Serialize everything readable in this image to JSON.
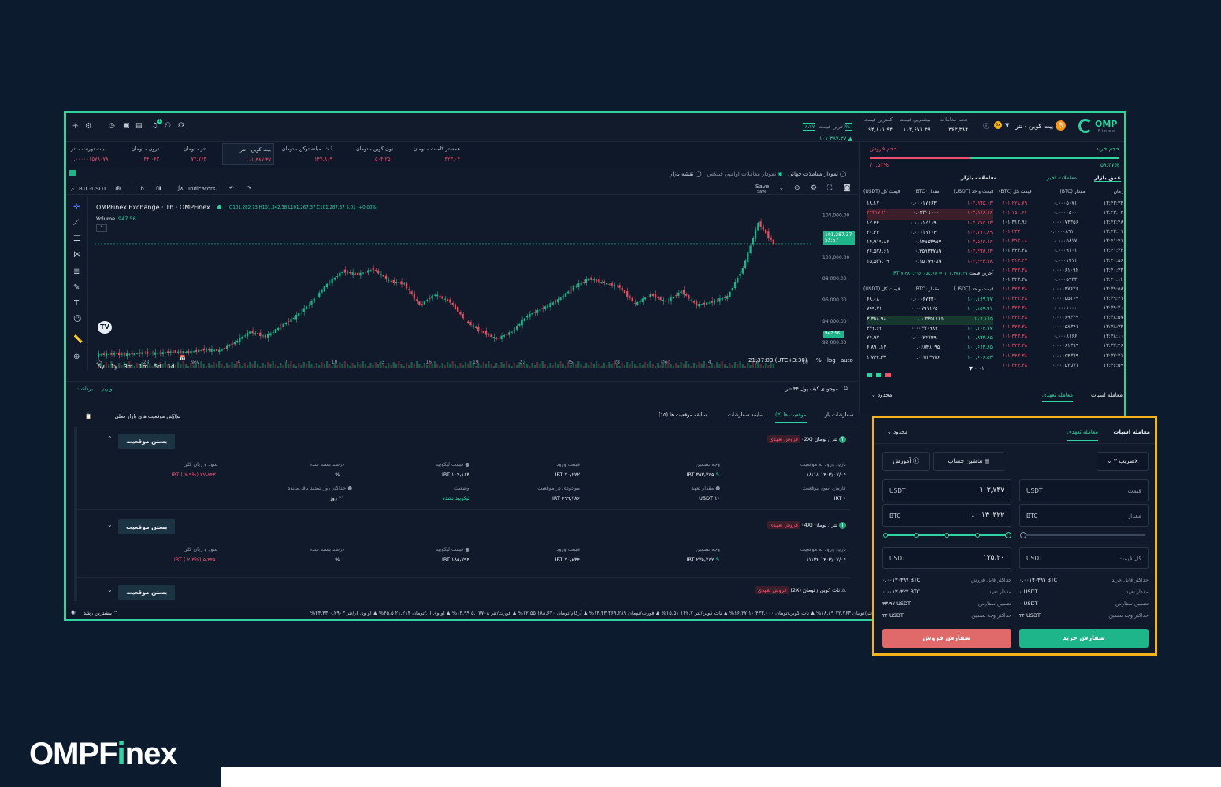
{
  "header": {
    "pair": "بیت کوین - تتر",
    "brand": "OMP",
    "brand_sub": "Finex",
    "stats": [
      {
        "label": "حجم معاملات",
        "value": "۳۶۳,۳۸۴"
      },
      {
        "label": "بیشترین قیمت",
        "value": "۱۰۳,۶۷۱.۳۹"
      },
      {
        "label": "کمترین قیمت",
        "value": "۹۴,۸۰۱.۹۴"
      },
      {
        "label": "آخرین قیمت",
        "value": "۱۰۱,۳۸۷.۳۷",
        "change": "۶.۷۷%"
      }
    ],
    "notif_count": "1"
  },
  "tickers": [
    {
      "name": "همستر کامبت - تومان",
      "value": "۳۲۳.۰۴"
    },
    {
      "name": "تون کوین - تومان",
      "value": "۵۰۴,۲۵۰"
    },
    {
      "name": "آ.ث. میلنه توکن - تومان",
      "value": "۱۴۷,۸۱۹"
    },
    {
      "name": "بیت کوین - تتر",
      "value": "۱۰۱,۳۸۷.۳۷"
    },
    {
      "name": "تتر - تومان",
      "value": "۷۲,۷۶۳"
    },
    {
      "name": "ترون - تومان",
      "value": "۴۴,۰۶۲"
    },
    {
      "name": "بیت تورنت - تتر",
      "value": "۰.۰۰۰۰۰۱۵۷۸۰۷۸"
    }
  ],
  "chart_opts": {
    "opt1": "نمودار معاملات جهانی",
    "opt2": "نمودار معاملات اوامپی فینکس",
    "opt3": "نقشه بازار"
  },
  "chart_toolbar": {
    "symbol": "BTC-USDT",
    "interval": "1h",
    "indicators": "Indicators",
    "save": "Save",
    "save_sub": "Save"
  },
  "chart_legend": {
    "title": "OMPFinex Exchange · 1h · OMPFinex",
    "ohlc": "O101,282.73 H101,342.38 L101,267.37 C101,287.37 5.01 (+0.00%)",
    "volume_label": "Volume",
    "volume_value": "947.56"
  },
  "chart_data": {
    "type": "line",
    "x": [
      "25",
      "28",
      "Nov",
      "4",
      "7",
      "10",
      "13",
      "16",
      "19",
      "22",
      "25",
      "28",
      "Dec",
      "4",
      "7",
      "10"
    ],
    "y_ticks": [
      "104,000.00",
      "102,000.00",
      "100,000.00",
      "98,000.00",
      "96,000.00",
      "94,000.00",
      "92,000.00"
    ],
    "ylim": [
      90500,
      105000
    ],
    "last_price": "101,287.37",
    "last_time": "52:57",
    "last_volume": "947.56",
    "values": [
      90800,
      90900,
      90850,
      91000,
      90950,
      91100,
      91050,
      91300,
      91200,
      92000,
      93000,
      92500,
      93500,
      94500,
      95800,
      97500,
      98700,
      98400,
      98900,
      97800,
      97500,
      95500,
      96500,
      95800,
      94000,
      93000,
      92300,
      93000,
      94500,
      95200,
      96000,
      97200,
      98000,
      97600,
      97200,
      95600,
      96500,
      95800,
      96800,
      95500,
      95800,
      96300,
      99000,
      103300,
      101300
    ]
  },
  "range_buttons": [
    "5y",
    "1y",
    "3m",
    "1m",
    "5d",
    "1d"
  ],
  "chart_footer": {
    "time": "21:37:03 (UTC+3:30)",
    "pct": "%",
    "log": "log",
    "auto": "auto"
  },
  "orderbook": {
    "buy_vol_label": "حجم خرید",
    "buy_vol": "۵۹.۴۷%",
    "sell_vol_label": "حجم فروش",
    "sell_vol": "۴۰.۵۳%",
    "tab_depth": "عمق بازار",
    "tab_trades": "معاملات اخیر",
    "tab_market": "معاملات بازار",
    "cols_left": [
      "قیمت واحد (USDT)",
      "مقدار (BTC)",
      "قیمت کل (USDT)"
    ],
    "cols_right": [
      "زمان",
      "مقدار (BTC)",
      "قیمت کل (BTC)"
    ],
    "asks": [
      [
        "۱۰۲,۹۳۵.۰۳",
        "۰.۰۰۰۱۷۶۶۳",
        "۱۸.۱۷"
      ],
      [
        "۱۰۲,۹۱۶.۶۶",
        "۰.۰۴۳۰۶۰۰۰",
        "۴۴۳۱۷.۲"
      ],
      [
        "۱۰۲,۷۷۵.۶۳",
        "۰.۰۰۰۱۲۱۰۹",
        "۱۲.۴۴"
      ],
      [
        "۱۰۲,۷۴۰.۸۹",
        "۰.۰۰۰۱۹۷۰۴",
        "۲۰.۲۴"
      ],
      [
        "۱۰۲,۵۱۶.۱۶",
        "۰.۱۴۵۵۳۹۵۹",
        "۱۴,۹۱۹.۸۶"
      ],
      [
        "۱۰۲,۴۳۸.۱۴",
        "۰.۲۵۹۴۳۷۸۷",
        "۲۶,۵۷۸.۶۱"
      ],
      [
        "۱۰۲,۴۹۳.۳۸",
        "۰.۱۵۱۷۹۰۸۷",
        "۱۵,۵۲۷.۱۹"
      ]
    ],
    "last_label": "آخرین قیمت",
    "last_value": "۱۰۱,۳۸۷.۳۷ = ۷,۳۸۱,۲۱۶,۰۵۵.۷۸ IRT",
    "bids": [
      [
        "۱۰۱,۱۶۹.۴۷",
        "۰.۰۰۰۶۷۳۳۰",
        "۶۸.۰۸"
      ],
      [
        "۱۰۱,۱۵۹.۴۱",
        "۰.۰۰۷۴۱۱۲۵",
        "۷۴۹.۷۱"
      ],
      [
        "۱۰۱,۱۱۵",
        "۰.۰۳۳۵۱۶۱۵",
        "۳,۳۸۸.۹۸"
      ],
      [
        "۱۰۱,۱۰۴.۷۷",
        "۰.۰۰۳۳۰۹۸۴",
        "۳۳۴.۶۴"
      ],
      [
        "۱۰۰,۸۳۳.۸۵",
        "۰.۰۰۰۲۶۷۴۹",
        "۲۶.۹۷"
      ],
      [
        "۱۰۰,۶۱۳.۸۵",
        "۰.۰۶۸۴۸۰۹۵",
        "۶,۸۹۰.۱۳"
      ],
      [
        "۱۰۰,۶۰۶.۵۳",
        "۰.۰۱۷۱۳۹۷۶",
        "۱,۷۲۴.۳۷"
      ]
    ],
    "step": "۰.۰۱",
    "trades": [
      [
        "۱۳:۴۳:۳۳",
        "۰.۰۰۰۵۰۷۱",
        "۱۰۱,۲۲۸.۷۹"
      ],
      [
        "۱۳:۴۳:۰۴",
        "۰.۰۰۰۰۵۰۰",
        "۱۰۱,۱۵۰.۶۴"
      ],
      [
        "۱۳:۴۲:۴۸",
        "۰.۰۰۰۷۳۳۵۶",
        "۱۰۱,۳۱۲.۹۶"
      ],
      [
        "۱۳:۴۲:۰۱",
        "۰.۰۰۰۰۸۹۱",
        "۱۰۱,۲۳۳"
      ],
      [
        "۱۳:۴۱:۴۱",
        "۰.۰۰۰۵۸۱۷",
        "۱۰۱,۳۵۲.۰۸"
      ],
      [
        "۱۳:۴۱:۳۳",
        "۰.۰۰۰۹۱۰۱",
        "۱۰۱,۳۴۳.۳۸"
      ],
      [
        "۱۳:۴۰:۵۶",
        "۰.۰۰۰۱۴۱۱",
        "۱۰۱,۴۱۳.۴۷"
      ],
      [
        "۱۳:۴۰:۳۳",
        "۰.۰۰۰۶۱۰۹۲",
        "۱۰۱,۳۴۳.۳۸"
      ],
      [
        "۱۳:۴۰:۱۲",
        "۰.۰۰۰۵۹۳۳",
        "۱۰۱,۳۴۳.۳۸"
      ],
      [
        "۱۳:۳۹:۵۸",
        "۰.۰۰۰۴۷۶۲۶",
        "۱۰۱,۳۴۳.۳۸"
      ],
      [
        "۱۳:۳۹:۴۱",
        "۰.۰۰۰۵۵۱۶۹",
        "۱۰۱,۳۴۳.۳۸"
      ],
      [
        "۱۳:۳۹:۲۰",
        "۰.۰۰۰۱۰۰۰",
        "۱۰۱,۳۴۳.۳۸"
      ],
      [
        "۱۳:۳۸:۵۷",
        "۰.۰۰۰۶۹۳۲۹",
        "۱۰۱,۳۴۳.۳۸"
      ],
      [
        "۱۳:۳۸:۳۳",
        "۰.۰۰۰۵۸۳۴۱",
        "۱۰۱,۳۴۳.۳۸"
      ],
      [
        "۱۳:۳۸:۱۰",
        "۰.۰۰۰۸۱۶۶",
        "۱۰۱,۳۴۳.۳۸"
      ],
      [
        "۱۳:۳۷:۴۶",
        "۰.۰۰۰۶۱۳۹۹",
        "۱۰۱,۳۴۳.۳۸"
      ],
      [
        "۱۳:۳۷:۲۱",
        "۰.۰۰۰۵۴۳۷۹",
        "۱۰۱,۳۴۳.۳۸"
      ],
      [
        "۱۳:۳۶:۵۹",
        "۰.۰۰۰۵۲۵۷۱",
        "۱۰۱,۳۴۳.۳۸"
      ]
    ]
  },
  "trade_tabs_bg": {
    "spot": "معامله اسپات",
    "margin": "معامله تعهدی",
    "limit": "محدود"
  },
  "wallet": {
    "label": "موجودی کیف پول",
    "value": "۴۴ تتر",
    "deposit": "واریز",
    "withdraw": "برداشت"
  },
  "pos_tabs": [
    "سفارشات باز",
    "موقعیت ها (۳)",
    "سابقه سفارشات",
    "سابقه موقعیت ها (۱۵)"
  ],
  "show_current_market": "نمایش موقعیت های بازار فعلی",
  "close_label": "بستن موقعیت",
  "positions": [
    {
      "pair": "تتر / تومان",
      "lev": "(2X)",
      "type": "فروش تعهدی",
      "fields": [
        {
          "l": "تاریخ ورود به موقعیت",
          "v": "۱۴۰۳/۰۷/۰۶ ۱۸:۱۸"
        },
        {
          "l": "وجه تضمین",
          "v": "۳۵۳,۳۶۵ IRT"
        },
        {
          "l": "قیمت ورود",
          "v": "۷۰,۴۷۲ IRT"
        },
        {
          "l": "قیمت لیکویید",
          "v": "۱۰۴,۱۶۳ IRT"
        },
        {
          "l": "درصد بسته شده",
          "v": "۰ %"
        },
        {
          "l": "سود و زیان کلی",
          "v": "-۲۷,۸۴۳ IRT (-۷.۹%)"
        }
      ],
      "fields2": [
        {
          "l": "کارمزد سود موقعیت",
          "v": "۰ IRT"
        },
        {
          "l": "مقدار تعهد",
          "v": "۱۰ USDT"
        },
        {
          "l": "موجودی در موقعیت",
          "v": "۶۹۹,۷۸۶ IRT"
        },
        {
          "l": "وضعیت",
          "v": "لیکویید نشده"
        },
        {
          "l": "حداکثر روز تمدید باقی‌مانده",
          "v": "۲۱ روز"
        }
      ]
    },
    {
      "pair": "تتر / تومان",
      "lev": "(4X)",
      "type": "فروش تعهدی",
      "fields": [
        {
          "l": "تاریخ ورود به موقعیت",
          "v": "۱۴۰۳/۰۷/۰۶ ۱۷:۳۴"
        },
        {
          "l": "وجه تضمین",
          "v": "۲۳۵,۲۶۲ IRT"
        },
        {
          "l": "قیمت ورود",
          "v": "۷۰,۵۳۴ IRT"
        },
        {
          "l": "قیمت لیکویید",
          "v": "۱۸۵,۷۹۴ IRT"
        },
        {
          "l": "درصد بسته شده",
          "v": "۰ %"
        },
        {
          "l": "سود و زیان کلی",
          "v": "-۵,۴۴۵ IRT (-۲.۳%)"
        }
      ]
    },
    {
      "pair": "ناث کوین / تومان",
      "lev": "(2X)",
      "type": "فروش تعهدی"
    }
  ],
  "ticker2": "تتر/تومان ۷۲,۷۶۳ ۱۸.۱۹% ▲ نات کوین/تومان ۱۰,۴۳۳.۰۰۰ ۱۶.۲۷% ▲ نات کوین/تتر ۱۴۲.۷ ۱۵.۵۱% ▲ فورت/تومان ۳۶۹,۲۸۹ ۱۴.۴۳% ▲ آرکام/تومان ۱۸۸,۶۲۰ ۱۲.۵۵% ▲ فورت/تتر ۵.۰۷۷۰۸ ۱۳.۹۹% ▲ او وی ال/تومان ۲۱,۲۱۴ ۴۵.۵% ▲ او وی ار/تتر ۰.۲۹۰۳ ۴۳.۴۳%",
  "more_label": "بیشترین رشد",
  "panel": {
    "tab_spot": "معامله اسپات",
    "tab_margin": "معامله تعهدی",
    "limit": "محدود",
    "multiplier": "ضریب ۳x",
    "calculator": "ماشین حساب",
    "tutorial": "آموزش",
    "buy_price_ph": "قیمت",
    "buy_price_unit": "USDT",
    "buy_amount_ph": "مقدار",
    "buy_amount_unit": "BTC",
    "buy_total_ph": "کل قیمت",
    "buy_total_unit": "USDT",
    "sell_price": "۱۰۳,۷۴۷",
    "sell_price_unit": "USDT",
    "sell_amount": "۰.۰۰۱۳۰۳۲۲",
    "sell_amount_unit": "BTC",
    "sell_total": "۱۳۵.۲۰",
    "sell_total_unit": "USDT",
    "buy_info": [
      {
        "l": "حداکثر قابل خرید",
        "v": "۰.۰۰۱۳۰۳۹۷ BTC"
      },
      {
        "l": "مقدار تعهد",
        "v": "۰ USDT"
      },
      {
        "l": "تضمین سفارش",
        "v": "۰ USDT"
      },
      {
        "l": "حداکثر وجه تضمین",
        "v": "۴۴ USDT"
      }
    ],
    "sell_info": [
      {
        "l": "حداکثر قابل فروش",
        "v": "۰.۰۰۱۳۰۳۹۷ BTC"
      },
      {
        "l": "مقدار تعهد",
        "v": "۰.۰۰۱۳۰۳۲۲ BTC"
      },
      {
        "l": "تضمین سفارش",
        "v": "۴۳.۹۷ USDT"
      },
      {
        "l": "حداکثر وجه تضمین",
        "v": "۴۴ USDT"
      }
    ],
    "buy_btn": "سفارش خرید",
    "sell_btn": "سفارش فروش",
    "buy_color": "#1fb58a",
    "sell_color": "#e06a6a"
  },
  "brand_logo": {
    "a": "OMPF",
    "b": "i",
    "c": "nex"
  }
}
